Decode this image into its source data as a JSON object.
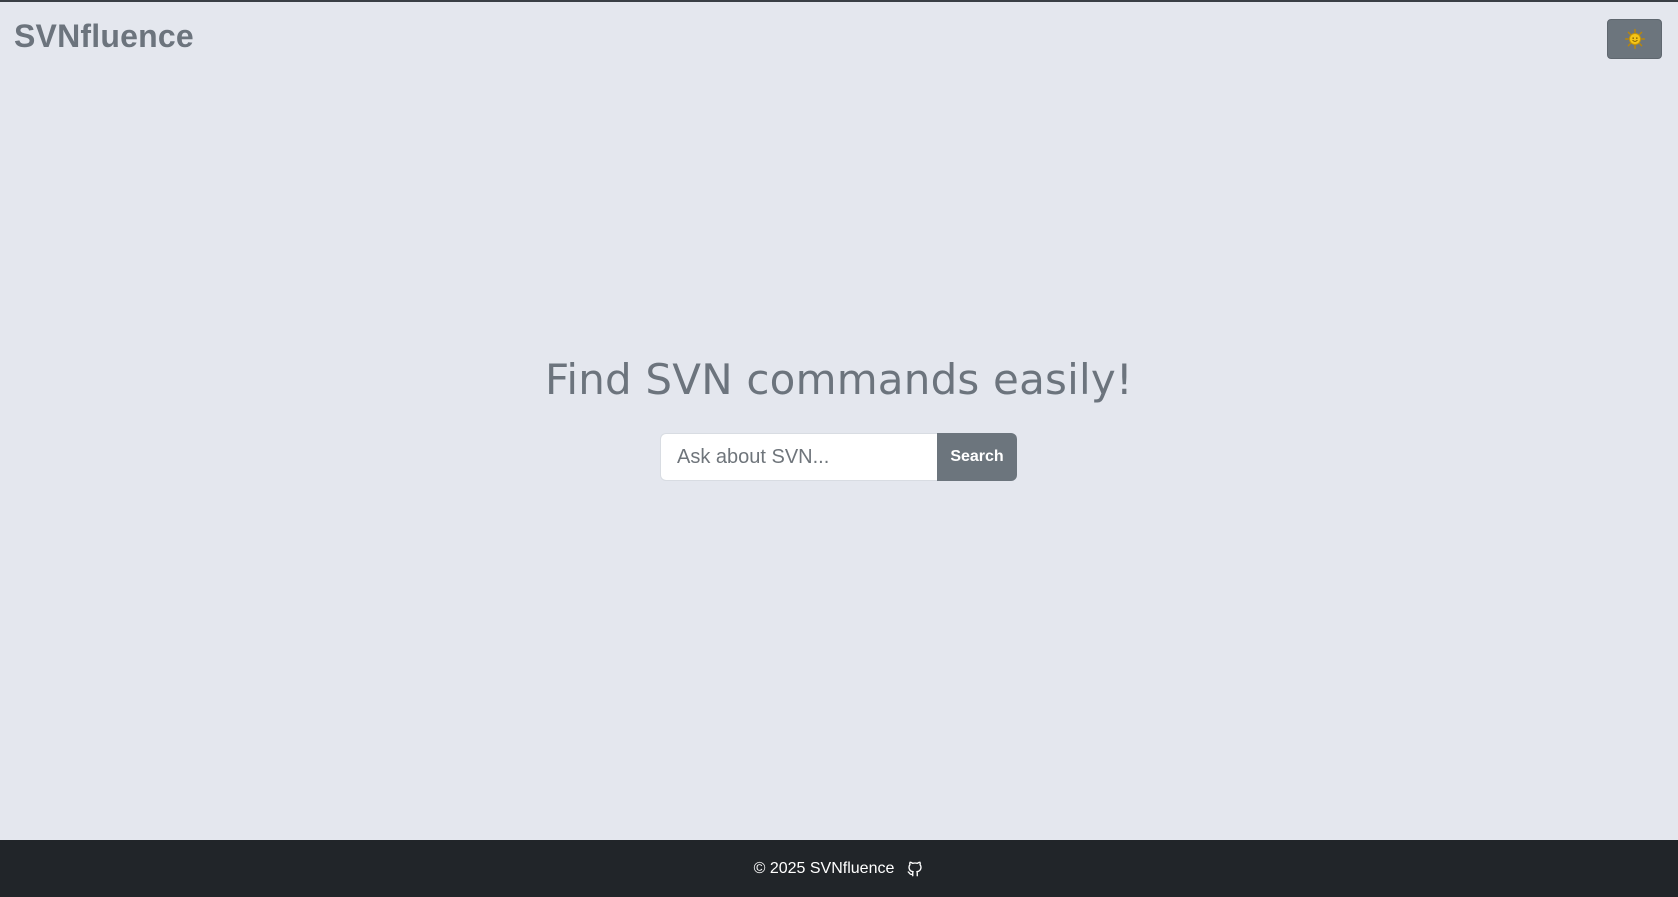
{
  "header": {
    "brand": "SVNfluence",
    "theme_toggle_icon": "sun-icon"
  },
  "hero": {
    "title": "Find SVN commands easily!"
  },
  "search": {
    "placeholder": "Ask about SVN...",
    "value": "",
    "button_label": "Search"
  },
  "footer": {
    "text": "© 2025 SVNfluence",
    "link_icon": "github-icon"
  },
  "colors": {
    "background": "#e4e7ee",
    "accent_button": "#6c757d",
    "footer_bg": "#212529",
    "brand_text": "#6c747d"
  }
}
